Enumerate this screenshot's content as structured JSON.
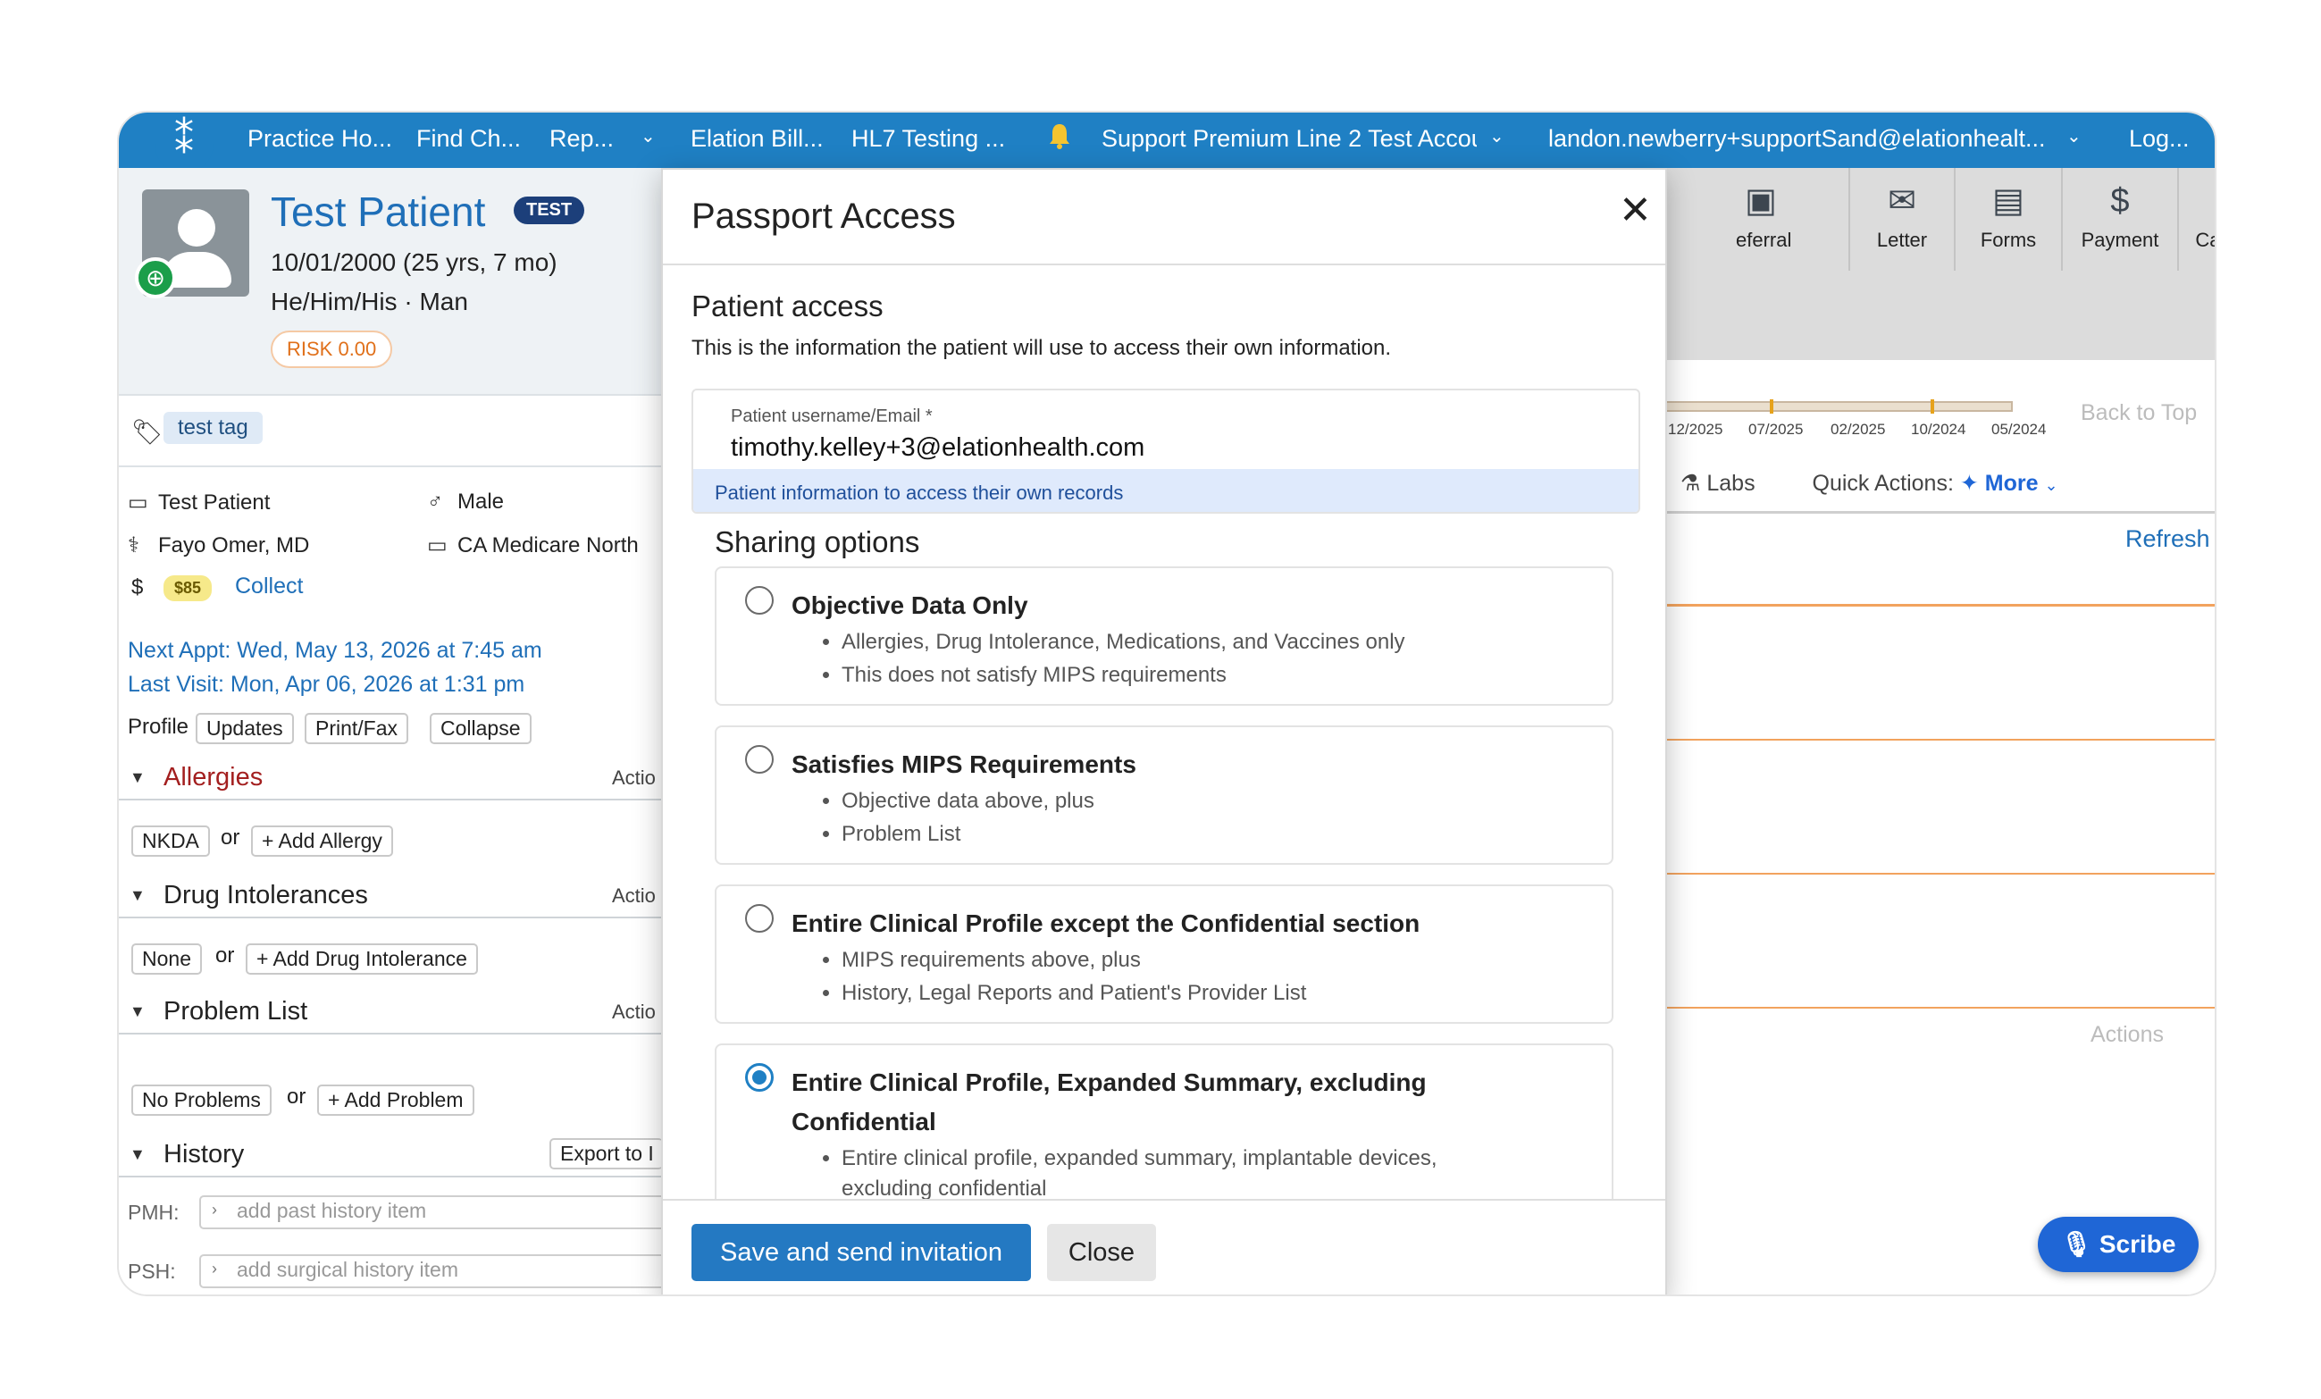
{
  "nav": {
    "items": [
      "Practice Ho...",
      "Find Ch...",
      "Rep...",
      "Elation Bill...",
      "HL7 Testing ...",
      "Support Premium Line 2 Test Accou",
      "landon.newberry+supportSand@elationhealt...",
      "Log..."
    ]
  },
  "patient": {
    "name": "Test Patient",
    "badge": "TEST",
    "dob": "10/01/2000 (25 yrs, 7 mo)",
    "pronouns": "He/Him/His · Man",
    "risk": "RISK 0.00",
    "tag": "test tag",
    "display_name": "Test Patient",
    "sex": "Male",
    "provider": "Fayo Omer, MD",
    "insurance": "CA Medicare North",
    "balance": "$85",
    "collect": "Collect",
    "next_appt": "Next Appt: Wed, May 13, 2026 at 7:45 am",
    "last_visit": "Last Visit: Mon, Apr 06, 2026 at 1:31 pm"
  },
  "profile": {
    "label": "Profile",
    "buttons": [
      "Updates",
      "Print/Fax",
      "Collapse"
    ]
  },
  "sections": {
    "allergies": {
      "title": "Allergies",
      "action": "Actio",
      "none_btn": "NKDA",
      "or": "or",
      "add_btn": "+ Add Allergy"
    },
    "intolerances": {
      "title": "Drug Intolerances",
      "action": "Actio",
      "none_btn": "None",
      "or": "or",
      "add_btn": "+ Add Drug Intolerance"
    },
    "problems": {
      "title": "Problem List",
      "action": "Actio",
      "none_btn": "No Problems",
      "or": "or",
      "add_btn": "+ Add Problem"
    },
    "history": {
      "title": "History",
      "export_btn": "Export to I",
      "pmh_label": "PMH:",
      "pmh_placeholder": "add past history item",
      "psh_label": "PSH:",
      "psh_placeholder": "add surgical history item"
    }
  },
  "toolbar": {
    "items": [
      "eferral",
      "Letter",
      "Forms",
      "Payment",
      "Care Team"
    ]
  },
  "timeline": {
    "labels": [
      "12/2025",
      "07/2025",
      "02/2025",
      "10/2024",
      "05/2024"
    ]
  },
  "right": {
    "back_to_top": "Back to Top",
    "labs": "Labs",
    "quick_actions": "Quick Actions:",
    "more": "More",
    "refresh": "Refresh",
    "actions": "Actions",
    "scribe": "Scribe"
  },
  "modal": {
    "title": "Passport Access",
    "section_title": "Patient access",
    "section_desc": "This is the information the patient will use to access their own information.",
    "field_label": "Patient username/Email *",
    "field_value": "timothy.kelley+3@elationhealth.com",
    "field_note": "Patient information to access their own records",
    "sharing_title": "Sharing options",
    "options": [
      {
        "title": "Objective Data Only",
        "bullets": [
          "Allergies, Drug Intolerance, Medications, and Vaccines only",
          "This does not satisfy MIPS requirements"
        ],
        "selected": false
      },
      {
        "title": "Satisfies MIPS Requirements",
        "bullets": [
          "Objective data above, plus",
          "Problem List"
        ],
        "selected": false
      },
      {
        "title": "Entire Clinical Profile except the Confidential section",
        "bullets": [
          "MIPS requirements above, plus",
          "History, Legal Reports and Patient's Provider List"
        ],
        "selected": false
      },
      {
        "title": "Entire Clinical Profile, Expanded Summary, excluding Confidential",
        "bullets": [
          "Entire clinical profile, expanded summary, implantable devices, excluding confidential"
        ],
        "selected": true
      }
    ],
    "save_button": "Save and send invitation",
    "close_button": "Close"
  },
  "colors": {
    "brand_blue": "#1f80c4",
    "link_blue": "#1f6fb8",
    "allergy_red": "#a31f1f",
    "risk_orange": "#e0701a",
    "panel_orange": "#f2a35e"
  }
}
